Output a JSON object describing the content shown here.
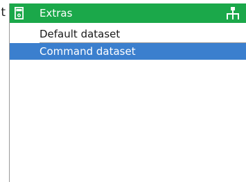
{
  "clipped_text": "t",
  "header": {
    "title": "Extras",
    "left_icon": "device-icon",
    "right_icon": "menu-tree-icon"
  },
  "menu": {
    "items": [
      {
        "label": "Default dataset",
        "selected": false
      },
      {
        "label": "Command dataset",
        "selected": true
      }
    ]
  },
  "colors": {
    "header_bg": "#1ba84a",
    "selection_bg": "#3b7fce",
    "text": "#1a1a1a",
    "selected_text": "#ffffff"
  }
}
